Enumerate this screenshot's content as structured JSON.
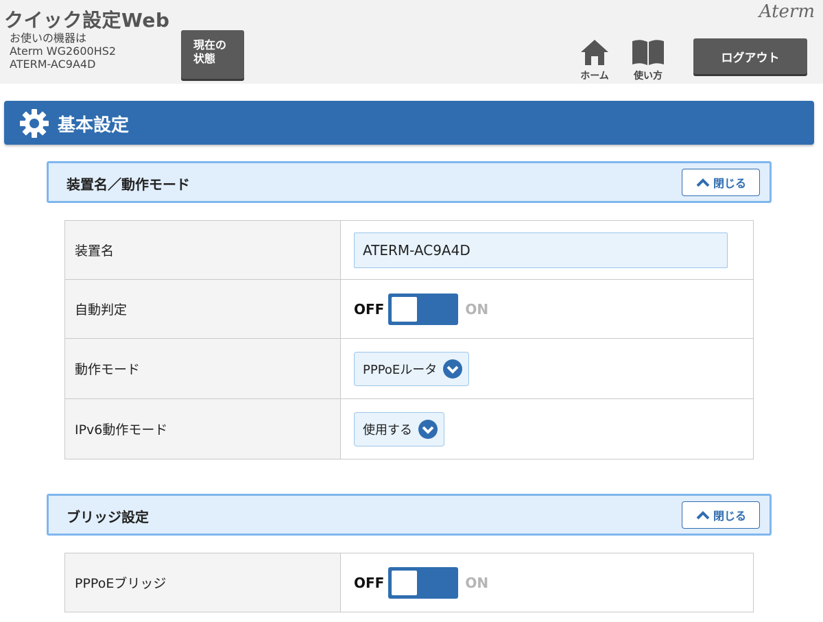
{
  "header": {
    "app_title": "クイック設定Web",
    "device_label": "お使いの機器は",
    "device_model": "Aterm WG2600HS2",
    "device_id": "ATERM-AC9A4D",
    "status_button_line1": "現在の",
    "status_button_line2": "状態",
    "brand": "Aterm",
    "home_label": "ホーム",
    "help_label": "使い方",
    "logout_label": "ログアウト"
  },
  "section": {
    "title": "基本設定",
    "icon": "gear-icon"
  },
  "panels": [
    {
      "title": "装置名／動作モード",
      "close_label": "閉じる",
      "rows": [
        {
          "label": "装置名",
          "value": "ATERM-AC9A4D"
        },
        {
          "label": "自動判定",
          "off_label": "OFF",
          "on_label": "ON",
          "state": "OFF"
        },
        {
          "label": "動作モード",
          "value": "PPPoEルータ"
        },
        {
          "label": "IPv6動作モード",
          "value": "使用する"
        }
      ]
    },
    {
      "title": "ブリッジ設定",
      "close_label": "閉じる",
      "rows": [
        {
          "label": "PPPoEブリッジ",
          "off_label": "OFF",
          "on_label": "ON",
          "state": "OFF"
        }
      ]
    }
  ],
  "colors": {
    "accent": "#2f6db0",
    "panel_bg": "#e1eefb",
    "panel_border": "#7fb6ee",
    "button_dark": "#5a5a5a"
  }
}
